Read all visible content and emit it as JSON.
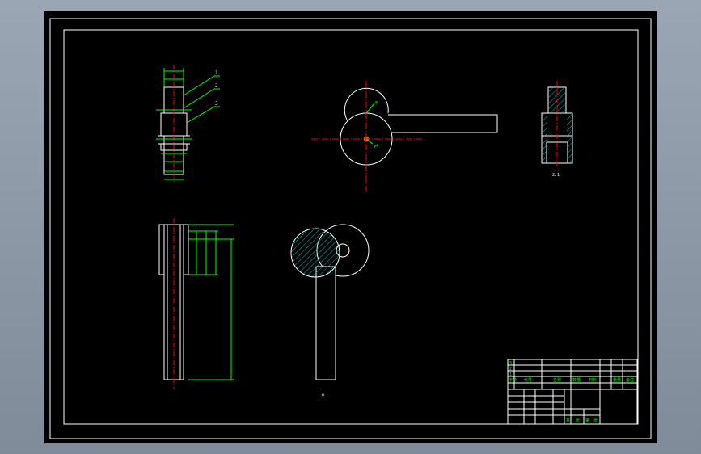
{
  "colors": {
    "background": "#000000",
    "frame": "#ffffff",
    "dimension": "#00ff00",
    "centerline": "#ff0000",
    "hatch": "#00c8c8",
    "outline": "#ffffff"
  },
  "views": {
    "side_leaders": [
      "1",
      "2",
      "3"
    ],
    "front_dim_top": "φ",
    "front_dim_center": "φ4",
    "top_view_label": "2:1",
    "section_label": "A"
  },
  "title_block": {
    "rows": [
      {
        "num": "3",
        "code": "",
        "name": ""
      },
      {
        "num": "2",
        "code": "",
        "name": ""
      },
      {
        "num": "1",
        "code": "",
        "name": ""
      }
    ],
    "header": [
      "序号",
      "代号",
      "名称",
      "数量",
      "材料",
      "重量",
      "备注"
    ],
    "drawing_name": "",
    "drawing_code": "",
    "scale_row": [
      "共",
      "张",
      "第",
      "张"
    ]
  }
}
